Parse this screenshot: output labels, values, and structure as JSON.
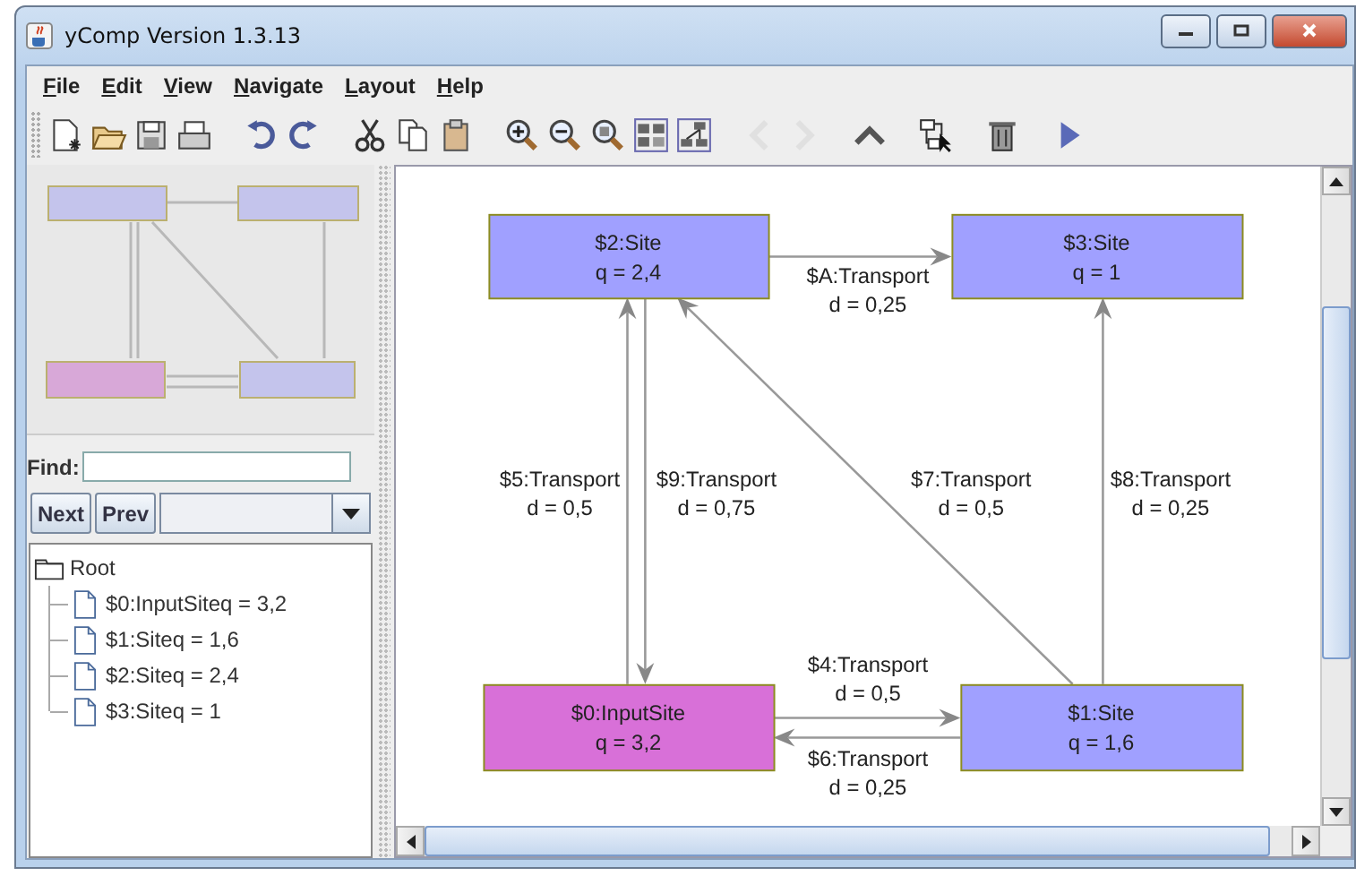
{
  "window": {
    "title": "yComp Version 1.3.13"
  },
  "menu": [
    "File",
    "Edit",
    "View",
    "Navigate",
    "Layout",
    "Help"
  ],
  "toolbar": [
    {
      "kind": "new",
      "disabled": false
    },
    {
      "kind": "open",
      "disabled": false
    },
    {
      "kind": "save",
      "disabled": false
    },
    {
      "kind": "print",
      "disabled": false
    },
    {
      "kind": "separator"
    },
    {
      "kind": "undo",
      "disabled": false
    },
    {
      "kind": "redo",
      "disabled": false
    },
    {
      "kind": "separator"
    },
    {
      "kind": "cut",
      "disabled": false
    },
    {
      "kind": "copy",
      "disabled": false
    },
    {
      "kind": "paste",
      "disabled": false
    },
    {
      "kind": "separator"
    },
    {
      "kind": "zoom-in",
      "disabled": false
    },
    {
      "kind": "zoom-out",
      "disabled": false
    },
    {
      "kind": "zoom-fit",
      "disabled": false
    },
    {
      "kind": "layout-grid",
      "disabled": false
    },
    {
      "kind": "layout-tree",
      "disabled": false
    },
    {
      "kind": "separator"
    },
    {
      "kind": "back",
      "disabled": true
    },
    {
      "kind": "forward",
      "disabled": true
    },
    {
      "kind": "separator"
    },
    {
      "kind": "up",
      "disabled": false
    },
    {
      "kind": "separator"
    },
    {
      "kind": "hierarchy",
      "disabled": false
    },
    {
      "kind": "separator"
    },
    {
      "kind": "delete",
      "disabled": false
    },
    {
      "kind": "separator"
    },
    {
      "kind": "play",
      "disabled": false
    }
  ],
  "find": {
    "label": "Find:"
  },
  "buttons": [
    "Next",
    "Prev"
  ],
  "tree": {
    "label": "Root",
    "children": [
      {
        "label": "$0:InputSiteq = 3,2"
      },
      {
        "label": "$1:Siteq = 1,6"
      },
      {
        "label": "$2:Siteq = 2,4"
      },
      {
        "label": "$3:Siteq = 1"
      }
    ]
  },
  "graph": {
    "nodes": [
      {
        "name": "$2:Site",
        "value": "q = 2,4",
        "color": "#a0a0ff"
      },
      {
        "name": "$3:Site",
        "value": "q = 1",
        "color": "#a0a0ff"
      },
      {
        "name": "$0:InputSite",
        "value": "q = 3,2",
        "color": "#d870d8"
      },
      {
        "name": "$1:Site",
        "value": "q = 1,6",
        "color": "#a0a0ff"
      }
    ],
    "edges": [
      {
        "name": "$A:Transport",
        "value": "d = 0,25"
      },
      {
        "name": "$5:Transport",
        "value": "d = 0,5"
      },
      {
        "name": "$9:Transport",
        "value": "d = 0,75"
      },
      {
        "name": "$7:Transport",
        "value": "d = 0,5"
      },
      {
        "name": "$8:Transport",
        "value": "d = 0,25"
      },
      {
        "name": "$4:Transport",
        "value": "d = 0,5"
      },
      {
        "name": "$6:Transport",
        "value": "d = 0,25"
      }
    ]
  }
}
